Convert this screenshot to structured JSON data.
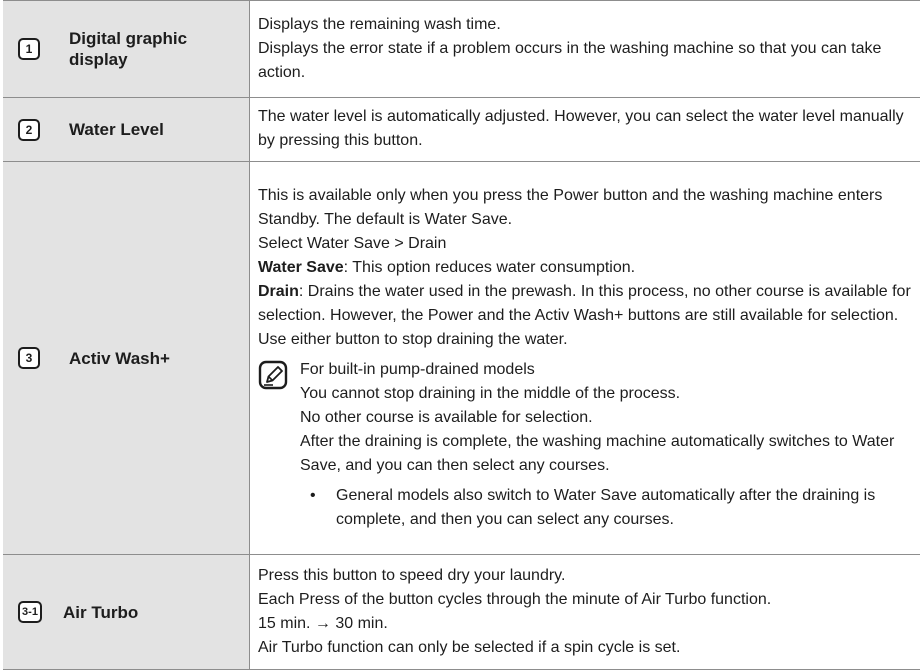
{
  "rows": [
    {
      "badge": "1",
      "label": "Digital graphic display",
      "lines": [
        "Displays the remaining wash time.",
        "Displays the error state if a problem occurs in the washing machine so that you can take action."
      ]
    },
    {
      "badge": "2",
      "label": "Water Level",
      "lines": [
        "The water level is automatically adjusted. However, you can select the water level manually by pressing this button."
      ]
    },
    {
      "badge": "3",
      "label": "Activ Wash+",
      "intro": "This is available only when you press the Power button and the washing machine enters Standby. The default is Water Save.",
      "select_line": "Select Water Save > Drain",
      "water_save_term": "Water Save",
      "water_save_text": ": This option reduces water consumption.",
      "drain_term": "Drain",
      "drain_text": ": Drains the water used in the prewash. In this process, no other course is available for selection. However, the Power and the Activ Wash+ buttons are still available for selection. Use either button to stop draining the water.",
      "note": {
        "icon": "note-pencil-icon",
        "lines": [
          "For built-in pump-drained models",
          "You cannot stop draining in the middle of the process.",
          "No other course is available for selection.",
          "After the draining is complete, the washing machine automatically switches to Water Save, and you can then select any courses."
        ],
        "bullet": "General models also switch to Water Save automatically after the draining is complete, and then you can select any courses."
      }
    },
    {
      "badge": "3-1",
      "label": "Air Turbo",
      "lines": [
        "Press this button to speed dry your laundry.",
        "Each Press of the button cycles through the minute of Air Turbo function.",
        "15 min. → 30 min.",
        "Air Turbo function can only be selected if a spin cycle is set."
      ]
    }
  ]
}
